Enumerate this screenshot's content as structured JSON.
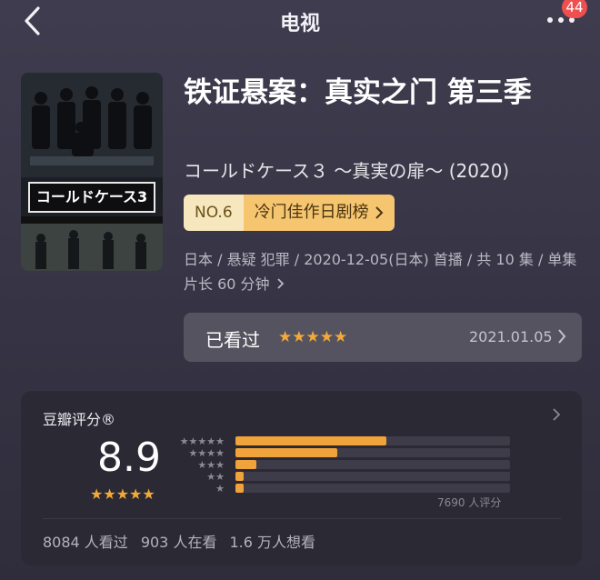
{
  "header": {
    "title": "电视",
    "notification_count": "44"
  },
  "poster": {
    "title_text": "コールドケース3",
    "colors": {
      "bg": "#1d2127"
    }
  },
  "show": {
    "title": "铁证悬案：真实之门 第三季",
    "subtitle": "コールドケース３ ～真実の扉～ (2020)",
    "rank_no": "NO.6",
    "rank_list": "冷门佳作日剧榜",
    "meta": "日本 / 悬疑 犯罪 / 2020-12-05(日本) 首播 / 共 10 集 / 单集片长 60 分钟"
  },
  "watched": {
    "label": "已看过",
    "stars": "★★★★★",
    "date": "2021.01.05"
  },
  "rating": {
    "title": "豆瓣评分®",
    "score": "8.9",
    "stars": "★★★★★",
    "raters": "7690 人评分",
    "distribution": [
      {
        "stars": "★★★★★",
        "fraction": 0.55
      },
      {
        "stars": "★★★★",
        "fraction": 0.37
      },
      {
        "stars": "★★★",
        "fraction": 0.075
      },
      {
        "stars": "★★",
        "fraction": 0.03
      },
      {
        "stars": "★",
        "fraction": 0.03
      }
    ],
    "stats": [
      "8084 人看过",
      "903 人在看",
      "1.6 万人想看"
    ]
  },
  "colors": {
    "accent": "#f3a93a",
    "badge": "#ee4f4f",
    "rank_label_bg": "#f6e7be",
    "rank_list_bg": "#f5c570"
  }
}
